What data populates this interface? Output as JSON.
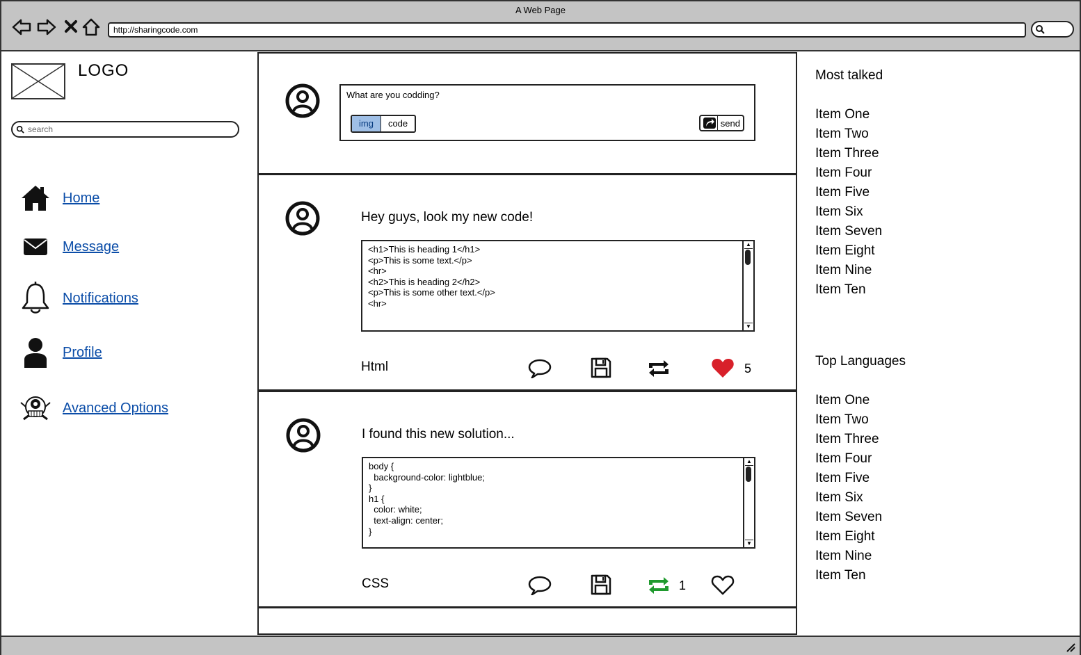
{
  "window": {
    "title": "A Web Page",
    "url": "http://sharingcode.com"
  },
  "sidebar": {
    "logo": "LOGO",
    "search_placeholder": "search",
    "nav": [
      {
        "label": "Home",
        "icon": "home-icon"
      },
      {
        "label": "Message",
        "icon": "envelope-icon"
      },
      {
        "label": "Notifications",
        "icon": "bell-icon"
      },
      {
        "label": "Profile",
        "icon": "user-icon"
      },
      {
        "label": "Avanced Options",
        "icon": "robot-icon"
      }
    ]
  },
  "composer": {
    "prompt": "What are you codding?",
    "tabs": [
      {
        "label": "img",
        "selected": true
      },
      {
        "label": "code",
        "selected": false
      }
    ],
    "send_label": "send"
  },
  "posts": [
    {
      "title": "Hey guys, look my new code!",
      "code": "<h1>This is heading 1</h1>\n<p>This is some text.</p>\n<hr>\n<h2>This is heading 2</h2>\n<p>This is some other text.</p>\n<hr>",
      "language": "Html",
      "retweeted": false,
      "retweet_count": "",
      "liked": true,
      "like_count": "5"
    },
    {
      "title": "I found this new solution...",
      "code": "body {\n  background-color: lightblue;\n}\nh1 {\n  color: white;\n  text-align: center;\n}",
      "language": "CSS",
      "retweeted": true,
      "retweet_count": "1",
      "liked": false,
      "like_count": ""
    }
  ],
  "right": {
    "most_talked_title": "Most talked",
    "most_talked": [
      "Item One",
      "Item Two",
      "Item Three",
      "Item Four",
      "Item Five",
      "Item Six",
      "Item Seven",
      "Item Eight",
      "Item Nine",
      "Item Ten"
    ],
    "top_languages_title": "Top Languages",
    "top_languages": [
      "Item One",
      "Item Two",
      "Item Three",
      "Item Four",
      "Item Five",
      "Item Six",
      "Item Seven",
      "Item Eight",
      "Item Nine",
      "Item Ten"
    ]
  },
  "colors": {
    "chrome": "#c4c4c4",
    "link": "#0b4da8",
    "like": "#d8202a",
    "retweet_active": "#1f9a2e",
    "tab_selected": "#9fbfe6"
  }
}
